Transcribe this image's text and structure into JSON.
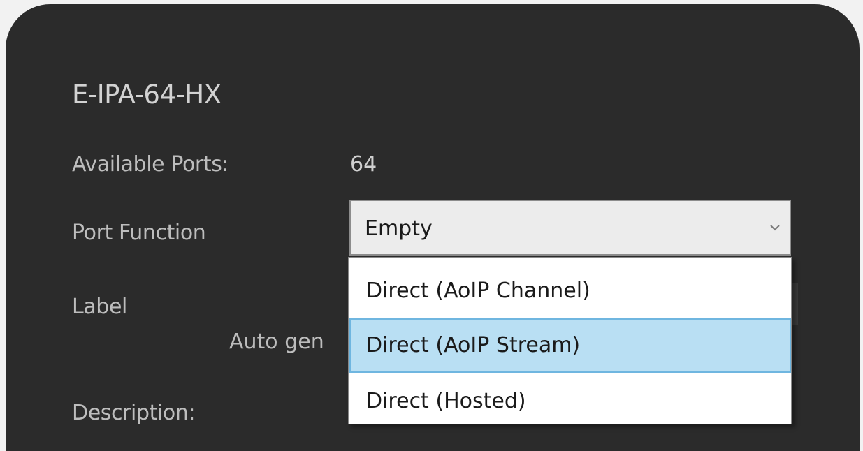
{
  "device": {
    "title": "E-IPA-64-HX"
  },
  "fields": {
    "available_ports_label": "Available Ports:",
    "available_ports_value": "64",
    "port_function_label": "Port Function",
    "label_label": "Label",
    "auto_generate_text": "Auto gen",
    "description_label": "Description:"
  },
  "port_function": {
    "selected_value": "Empty",
    "arrow_icon": "chevron-down-icon",
    "options": [
      {
        "label": "Direct (AoIP Channel)",
        "highlighted": false
      },
      {
        "label": "Direct (AoIP Stream)",
        "highlighted": true
      },
      {
        "label": "Direct (Hosted)",
        "highlighted": false
      }
    ]
  },
  "colors": {
    "panel_bg": "#2b2b2b",
    "highlight_bg": "#b9dff3",
    "highlight_border": "#6fb6e0"
  }
}
